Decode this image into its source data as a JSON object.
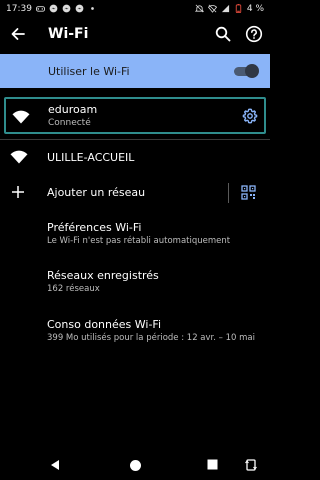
{
  "status_bar": {
    "time": "17:39",
    "battery": "4 %",
    "left_icons": [
      "game-controller-icon",
      "messenger-icon",
      "messenger-icon",
      "messenger-icon",
      "dot-icon"
    ],
    "right_icons": [
      "mute-icon",
      "wifi-off-icon",
      "signal-icon",
      "battery-low-icon"
    ]
  },
  "app_bar": {
    "title": "Wi-Fi",
    "back_icon": "arrow-back-icon",
    "search_icon": "search-icon",
    "help_icon": "help-icon"
  },
  "master_toggle": {
    "label": "Utiliser le Wi-Fi",
    "enabled": true,
    "accent_color": "#8ab4f8"
  },
  "connected_network": {
    "name": "eduroam",
    "status": "Connecté",
    "outline_color": "#2f8d8d"
  },
  "networks": [
    {
      "name": "ULILLE-ACCUEIL"
    }
  ],
  "add_network": {
    "label": "Ajouter un réseau"
  },
  "preferences": [
    {
      "title": "Préférences Wi-Fi",
      "subtitle": "Le Wi-Fi n'est pas rétabli automatiquement"
    },
    {
      "title": "Réseaux enregistrés",
      "subtitle": "162 réseaux"
    },
    {
      "title": "Conso données Wi-Fi",
      "subtitle": "399 Mo utilisés pour la période : 12 avr. – 10 mai"
    }
  ],
  "nav_bar": {
    "icons": [
      "nav-back-icon",
      "nav-home-icon",
      "nav-recents-icon",
      "rotate-icon"
    ]
  }
}
